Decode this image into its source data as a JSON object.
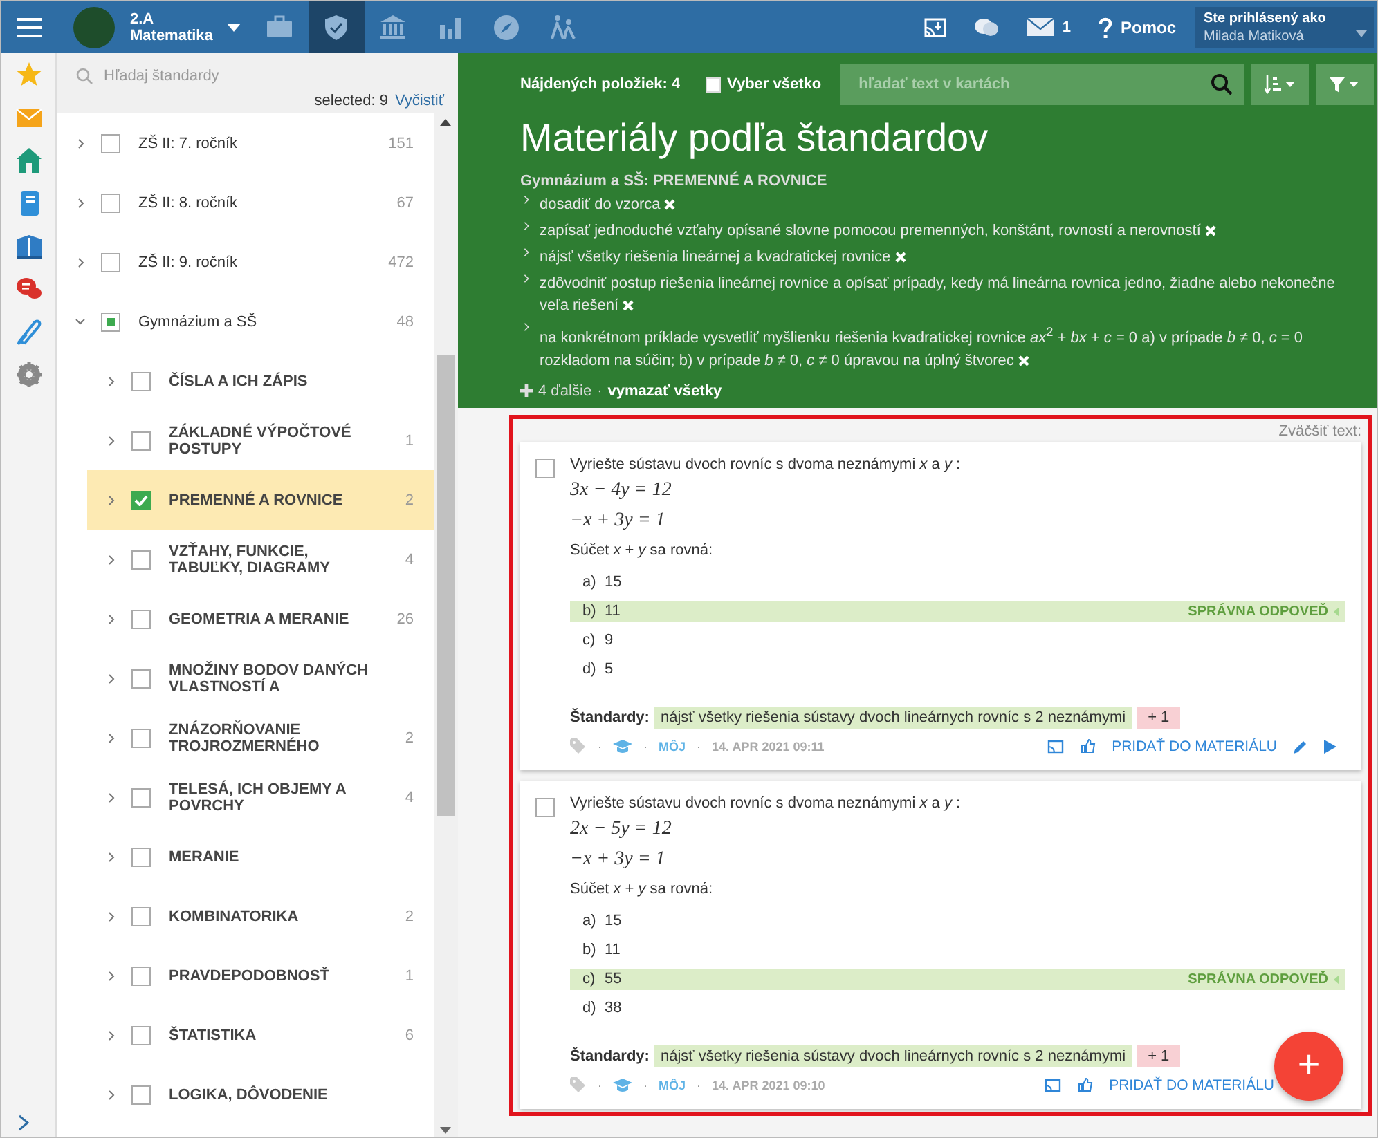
{
  "topbar": {
    "class_title": "2.A",
    "class_subject": "Matematika",
    "nav": [
      {
        "kind": "briefcase",
        "selected": false
      },
      {
        "kind": "shield",
        "selected": true
      },
      {
        "kind": "bank",
        "selected": false
      },
      {
        "kind": "chart",
        "selected": false
      },
      {
        "kind": "compass",
        "selected": false
      },
      {
        "kind": "hikers",
        "selected": false
      }
    ],
    "messages_count": "1",
    "help": "Pomoc",
    "user_label": "Ste prihlásený ako",
    "user_name": "Milada Matiková"
  },
  "rail": [
    {
      "kind": "star"
    },
    {
      "kind": "mail"
    },
    {
      "kind": "home"
    },
    {
      "kind": "notebook"
    },
    {
      "kind": "book"
    },
    {
      "kind": "chat"
    },
    {
      "kind": "pen"
    },
    {
      "kind": "gear"
    }
  ],
  "tree": {
    "search_placeholder": "Hľadaj štandardy",
    "selected_text": "selected: 9",
    "clear_link": "Vyčistiť",
    "items": [
      {
        "label": "ZŠ II: 7. ročník",
        "count": "151",
        "checked": false,
        "partial": false,
        "expanded": false,
        "selected": false
      },
      {
        "label": "ZŠ II: 8. ročník",
        "count": "67",
        "checked": false,
        "partial": false,
        "expanded": false,
        "selected": false
      },
      {
        "label": "ZŠ II: 9. ročník",
        "count": "472",
        "checked": false,
        "partial": false,
        "expanded": false,
        "selected": false
      },
      {
        "label": "Gymnázium a SŠ",
        "count": "48",
        "checked": false,
        "partial": true,
        "expanded": true,
        "selected": false,
        "children": [
          {
            "label": "ČÍSLA A ICH ZÁPIS",
            "checked": false,
            "partial": false,
            "expanded": false,
            "selected": false
          },
          {
            "label": "ZÁKLADNÉ VÝPOČTOVÉ POSTUPY",
            "count": "1",
            "checked": false,
            "partial": false,
            "expanded": false,
            "selected": false
          },
          {
            "label": "PREMENNÉ A ROVNICE",
            "count": "2",
            "checked": true,
            "partial": false,
            "expanded": false,
            "selected": true
          },
          {
            "label": "VZŤAHY, FUNKCIE, TABUĽKY, DIAGRAMY",
            "count": "4",
            "checked": false,
            "partial": false,
            "expanded": false,
            "selected": false
          },
          {
            "label": "GEOMETRIA A MERANIE",
            "count": "26",
            "checked": false,
            "partial": false,
            "expanded": false,
            "selected": false
          },
          {
            "label": "MNOŽINY BODOV DANÝCH VLASTNOSTÍ A",
            "checked": false,
            "partial": false,
            "expanded": false,
            "selected": false
          },
          {
            "label": "ZNÁZORŇOVANIE TROJROZMERNÉHO",
            "count": "2",
            "checked": false,
            "partial": false,
            "expanded": false,
            "selected": false
          },
          {
            "label": "TELESÁ, ICH OBJEMY A POVRCHY",
            "count": "4",
            "checked": false,
            "partial": false,
            "expanded": false,
            "selected": false
          },
          {
            "label": "MERANIE",
            "checked": false,
            "partial": false,
            "expanded": false,
            "selected": false
          },
          {
            "label": "KOMBINATORIKA",
            "count": "2",
            "checked": false,
            "partial": false,
            "expanded": false,
            "selected": false
          },
          {
            "label": "PRAVDEPODOBNOSŤ",
            "count": "1",
            "checked": false,
            "partial": false,
            "expanded": false,
            "selected": false
          },
          {
            "label": "ŠTATISTIKA",
            "count": "6",
            "checked": false,
            "partial": false,
            "expanded": false,
            "selected": false
          },
          {
            "label": "LOGIKA, DÔVODENIE",
            "checked": false,
            "partial": false,
            "expanded": false,
            "selected": false
          }
        ]
      }
    ]
  },
  "header": {
    "found": "Nájdených položiek: 4",
    "select_all": {
      "label": "Vyber všetko",
      "checked": false
    },
    "search_placeholder": "hľadať text v kartách",
    "title": "Materiály podľa štandardov",
    "standards_heading": "Gymnázium a SŠ: PREMENNÉ A ROVNICE",
    "standards": [
      "dosadiť do vzorca",
      "zapísať jednoduché vzťahy opísané slovne pomocou premenných, konštánt, rovností a nerovností",
      "nájsť všetky riešenia lineárnej a kvadratickej rovnice",
      "zdôvodniť postup riešenia lineárnej rovnice a opísať prípady, kedy má lineárna rovnica jedno, žiadne alebo nekonečne veľa riešení",
      "na konkrétnom príklade vysvetliť myšlienku riešenia kvadratickej rovnice *ax*$^{2}$ + *bx* + *c* = 0 a) v prípade *b* ≠ 0, *c* = 0 rozkladom na súčin; b) v prípade *b* ≠ 0, *c* ≠ 0 úpravou na úplný štvorec"
    ],
    "more": "4 ďalšie",
    "more_sep": "·",
    "clear_all": "vymazať všetky"
  },
  "zoom_label": "Zväčšiť text:",
  "cards": [
    {
      "checked": false,
      "question": "Vyriešte sústavu dvoch rovníc s dvoma neznámymi *x* a *y* :",
      "equations": [
        "3x − 4y = 12",
        "−x + 3y = 1"
      ],
      "prompt": "Súčet *x* + *y* sa rovná:",
      "options": [
        {
          "letter": "a)",
          "text": "15",
          "correct": false
        },
        {
          "letter": "b)",
          "text": "11",
          "correct": true
        },
        {
          "letter": "c)",
          "text": "9",
          "correct": false
        },
        {
          "letter": "d)",
          "text": "5",
          "correct": false
        }
      ],
      "correct_label": "SPRÁVNA ODPOVEĎ",
      "standards_label": "Štandardy:",
      "standard_tag": "nájsť všetky riešenia sústavy dvoch lineárnych rovníc s 2 neznámymi",
      "more_tag": "+ 1",
      "meta": [
        {
          "kind": "tag"
        },
        {
          "kind": "sep",
          "text": "·"
        },
        {
          "kind": "cap"
        },
        {
          "kind": "sep",
          "text": "·"
        },
        {
          "kind": "author",
          "text": "MÔJ"
        },
        {
          "kind": "sep",
          "text": "·"
        },
        {
          "kind": "date",
          "text": "14. APR 2021 09:11"
        }
      ],
      "add_label": "PRIDAŤ DO MATERIÁLU"
    },
    {
      "checked": false,
      "question": "Vyriešte sústavu dvoch rovníc s dvoma neznámymi *x* a *y* :",
      "equations": [
        "2x − 5y = 12",
        "−x + 3y = 1"
      ],
      "prompt": "Súčet *x* + *y* sa rovná:",
      "options": [
        {
          "letter": "a)",
          "text": "15",
          "correct": false
        },
        {
          "letter": "b)",
          "text": "11",
          "correct": false
        },
        {
          "letter": "c)",
          "text": "55",
          "correct": true
        },
        {
          "letter": "d)",
          "text": "38",
          "correct": false
        }
      ],
      "correct_label": "SPRÁVNA ODPOVEĎ",
      "standards_label": "Štandardy:",
      "standard_tag": "nájsť všetky riešenia sústavy dvoch lineárnych rovníc s 2 neznámymi",
      "more_tag": "+ 1",
      "meta": [
        {
          "kind": "tag"
        },
        {
          "kind": "sep",
          "text": "·"
        },
        {
          "kind": "cap"
        },
        {
          "kind": "sep",
          "text": "·"
        },
        {
          "kind": "author",
          "text": "MÔJ"
        },
        {
          "kind": "sep",
          "text": "·"
        },
        {
          "kind": "date",
          "text": "14. APR 2021 09:10"
        }
      ],
      "add_label": "PRIDAŤ DO MATERIÁLU"
    }
  ],
  "fab": "+"
}
